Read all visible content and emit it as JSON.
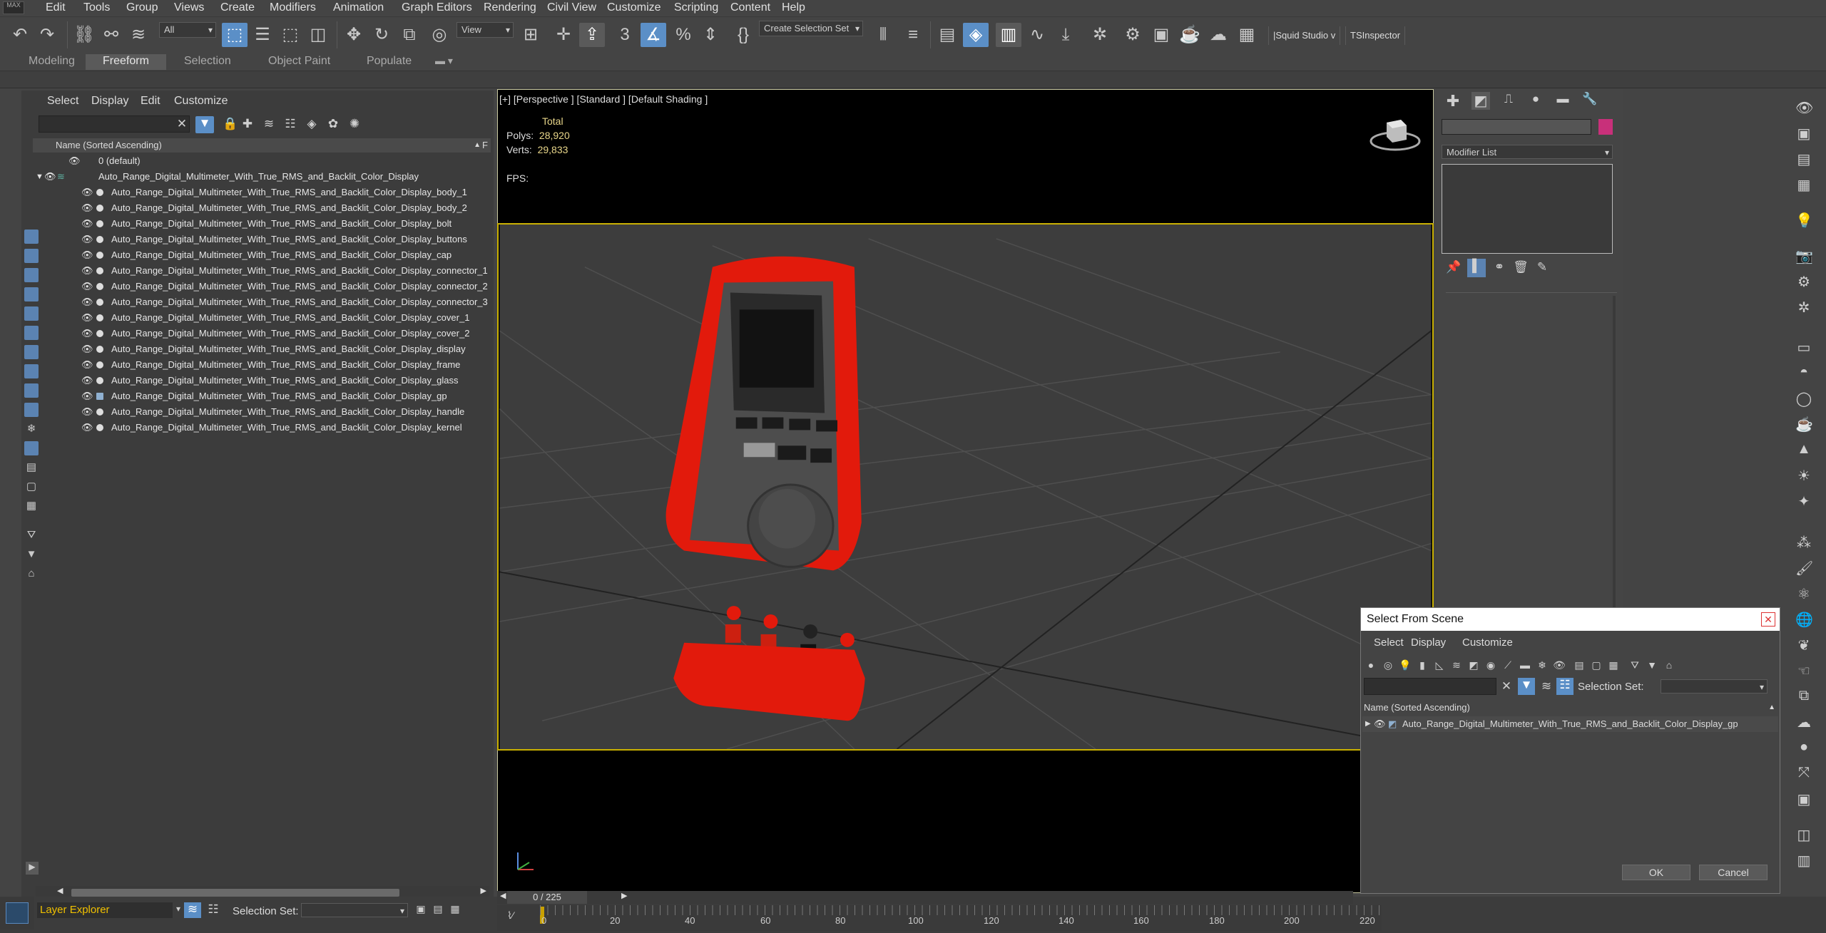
{
  "menubar": {
    "logo": "MAX",
    "items": [
      "Edit",
      "Tools",
      "Group",
      "Views",
      "Create",
      "Modifiers",
      "Animation",
      "Graph Editors",
      "Rendering",
      "Civil View",
      "Customize",
      "Scripting",
      "Content",
      "Help"
    ]
  },
  "toolbar": {
    "filter": "All",
    "refcoord": "View",
    "selection_set": "Create Selection Set",
    "squid": "|Squid Studio v",
    "tsinspector": "TSInspector"
  },
  "ribbon": {
    "tabs": [
      "Modeling",
      "Freeform",
      "Selection",
      "Object Paint",
      "Populate"
    ],
    "active": "Freeform"
  },
  "explorer": {
    "menu": [
      "Select",
      "Display",
      "Edit",
      "Customize"
    ],
    "column_header": "Name (Sorted Ascending)",
    "column_flag": "F",
    "rows": [
      "0 (default)",
      "Auto_Range_Digital_Multimeter_With_True_RMS_and_Backlit_Color_Display",
      "Auto_Range_Digital_Multimeter_With_True_RMS_and_Backlit_Color_Display_body_1",
      "Auto_Range_Digital_Multimeter_With_True_RMS_and_Backlit_Color_Display_body_2",
      "Auto_Range_Digital_Multimeter_With_True_RMS_and_Backlit_Color_Display_bolt",
      "Auto_Range_Digital_Multimeter_With_True_RMS_and_Backlit_Color_Display_buttons",
      "Auto_Range_Digital_Multimeter_With_True_RMS_and_Backlit_Color_Display_cap",
      "Auto_Range_Digital_Multimeter_With_True_RMS_and_Backlit_Color_Display_connector_1",
      "Auto_Range_Digital_Multimeter_With_True_RMS_and_Backlit_Color_Display_connector_2",
      "Auto_Range_Digital_Multimeter_With_True_RMS_and_Backlit_Color_Display_connector_3",
      "Auto_Range_Digital_Multimeter_With_True_RMS_and_Backlit_Color_Display_cover_1",
      "Auto_Range_Digital_Multimeter_With_True_RMS_and_Backlit_Color_Display_cover_2",
      "Auto_Range_Digital_Multimeter_With_True_RMS_and_Backlit_Color_Display_display",
      "Auto_Range_Digital_Multimeter_With_True_RMS_and_Backlit_Color_Display_frame",
      "Auto_Range_Digital_Multimeter_With_True_RMS_and_Backlit_Color_Display_glass",
      "Auto_Range_Digital_Multimeter_With_True_RMS_and_Backlit_Color_Display_gp",
      "Auto_Range_Digital_Multimeter_With_True_RMS_and_Backlit_Color_Display_handle",
      "Auto_Range_Digital_Multimeter_With_True_RMS_and_Backlit_Color_Display_kernel"
    ]
  },
  "viewport": {
    "label": "[+] [Perspective ] [Standard ] [Default Shading ]",
    "stats_total": "Total",
    "polys_label": "Polys:",
    "polys": "28,920",
    "verts_label": "Verts:",
    "verts": "29,833",
    "fps_label": "FPS:"
  },
  "command_panel": {
    "modifier_list": "Modifier List",
    "color_swatch": "#c8307a"
  },
  "dialog": {
    "title": "Select From Scene",
    "menu": [
      "Select",
      "Display",
      "Customize"
    ],
    "selection_set_label": "Selection Set:",
    "column_header": "Name (Sorted Ascending)",
    "item": "Auto_Range_Digital_Multimeter_With_True_RMS_and_Backlit_Color_Display_gp",
    "ok": "OK",
    "cancel": "Cancel"
  },
  "bottom": {
    "layer_explorer": "Layer Explorer",
    "selection_set_label": "Selection Set:",
    "frame_counter": "0 / 225",
    "ticks": [
      "0",
      "20",
      "40",
      "60",
      "80",
      "100",
      "120",
      "140",
      "160",
      "180",
      "200",
      "220"
    ]
  },
  "colors": {
    "accent": "#5b8fc7",
    "viewport_border": "#c9b000",
    "multimeter_red": "#e21a0c"
  }
}
